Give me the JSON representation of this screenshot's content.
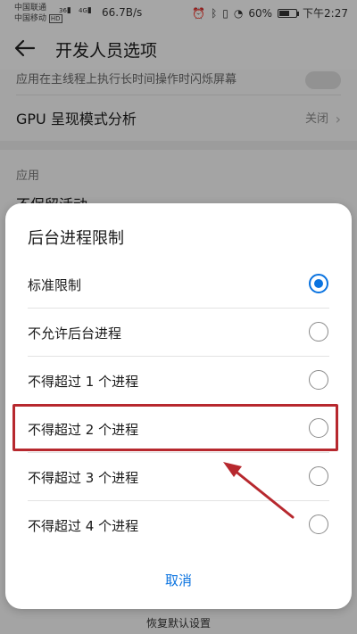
{
  "status_bar": {
    "carrier1": "中国联通",
    "carrier2": "中国移动",
    "hd_badge": "HD",
    "net1": "36",
    "net2": "4G",
    "speed": "66.7B/s",
    "battery": "60%",
    "battery_level": 0.6,
    "time": "下午2:27"
  },
  "app_bar": {
    "title": "开发人员选项"
  },
  "background": {
    "row1": "应用在主线程上执行长时间操作时闪烁屏幕",
    "row2_label": "GPU 呈现模式分析",
    "row2_value": "关闭",
    "section": "应用",
    "row3": "不保留活动",
    "bottom_action": "恢复默认设置"
  },
  "dialog": {
    "title": "后台进程限制",
    "options": [
      {
        "label": "标准限制",
        "selected": true
      },
      {
        "label": "不允许后台进程",
        "selected": false
      },
      {
        "label": "不得超过 1 个进程",
        "selected": false
      },
      {
        "label": "不得超过 2 个进程",
        "selected": false
      },
      {
        "label": "不得超过 3 个进程",
        "selected": false
      },
      {
        "label": "不得超过 4 个进程",
        "selected": false
      }
    ],
    "cancel": "取消"
  },
  "colors": {
    "accent": "#0a73e0",
    "annotation": "#b7282e"
  }
}
